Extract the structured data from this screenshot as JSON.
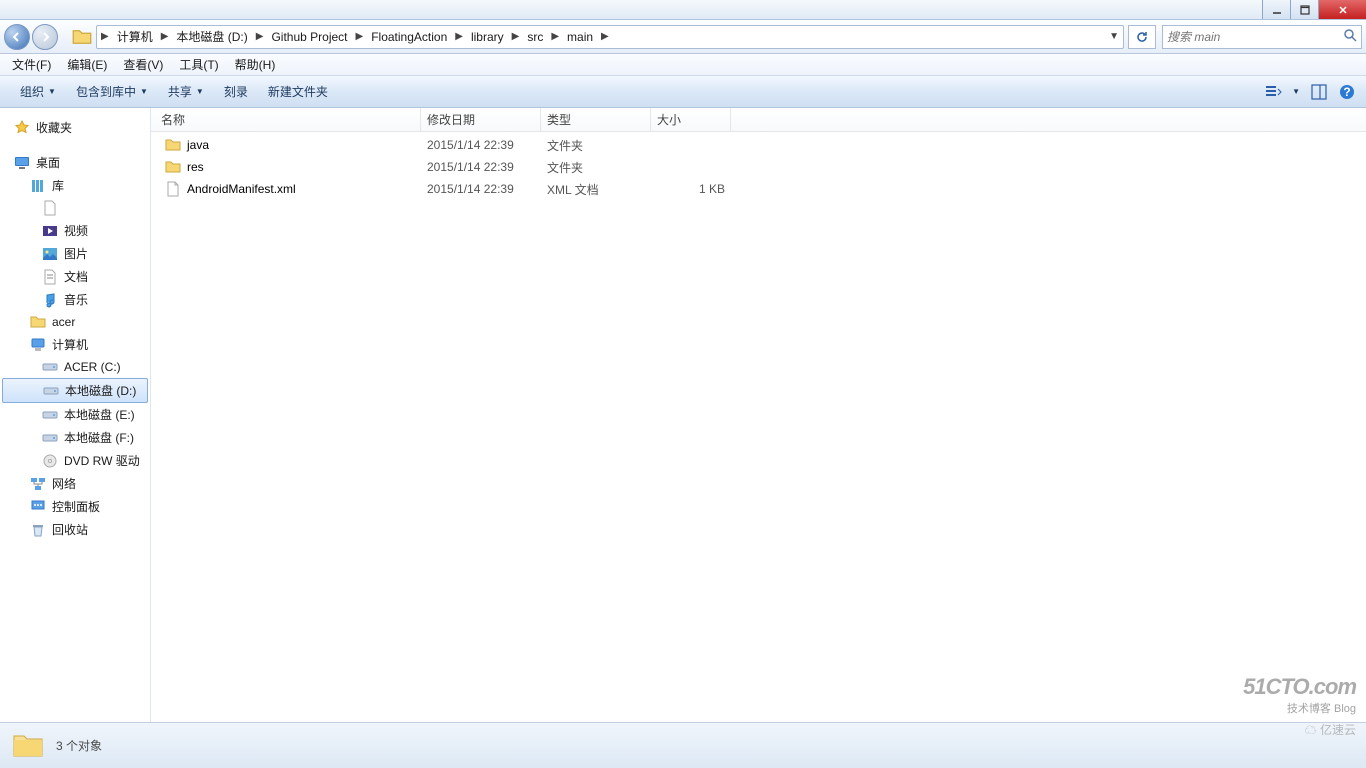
{
  "titlebar": {},
  "nav": {
    "crumbs": [
      "计算机",
      "本地磁盘 (D:)",
      "Github Project",
      "FloatingAction",
      "library",
      "src",
      "main"
    ],
    "search_placeholder": "搜索 main"
  },
  "menubar": {
    "items": [
      "文件(F)",
      "编辑(E)",
      "查看(V)",
      "工具(T)",
      "帮助(H)"
    ]
  },
  "toolbar": {
    "organize": "组织",
    "include": "包含到库中",
    "share": "共享",
    "burn": "刻录",
    "newfolder": "新建文件夹"
  },
  "sidebar": {
    "favorites": "收藏夹",
    "desktop": "桌面",
    "libraries": "库",
    "videos": "视频",
    "pictures": "图片",
    "documents": "文档",
    "music": "音乐",
    "acer_user": "acer",
    "computer": "计算机",
    "drive_c": "ACER (C:)",
    "drive_d": "本地磁盘 (D:)",
    "drive_e": "本地磁盘 (E:)",
    "drive_f": "本地磁盘 (F:)",
    "dvd": "DVD RW 驱动",
    "network": "网络",
    "control": "控制面板",
    "recycle": "回收站"
  },
  "columns": {
    "name": "名称",
    "date": "修改日期",
    "type": "类型",
    "size": "大小"
  },
  "files": [
    {
      "name": "java",
      "date": "2015/1/14 22:39",
      "type": "文件夹",
      "size": "",
      "icon": "folder"
    },
    {
      "name": "res",
      "date": "2015/1/14 22:39",
      "type": "文件夹",
      "size": "",
      "icon": "folder"
    },
    {
      "name": "AndroidManifest.xml",
      "date": "2015/1/14 22:39",
      "type": "XML 文档",
      "size": "1 KB",
      "icon": "file"
    }
  ],
  "status": {
    "count_text": "3 个对象"
  },
  "watermark": {
    "line1": "51CTO.com",
    "line2": "技术博客  Blog",
    "brand": "亿速云"
  }
}
